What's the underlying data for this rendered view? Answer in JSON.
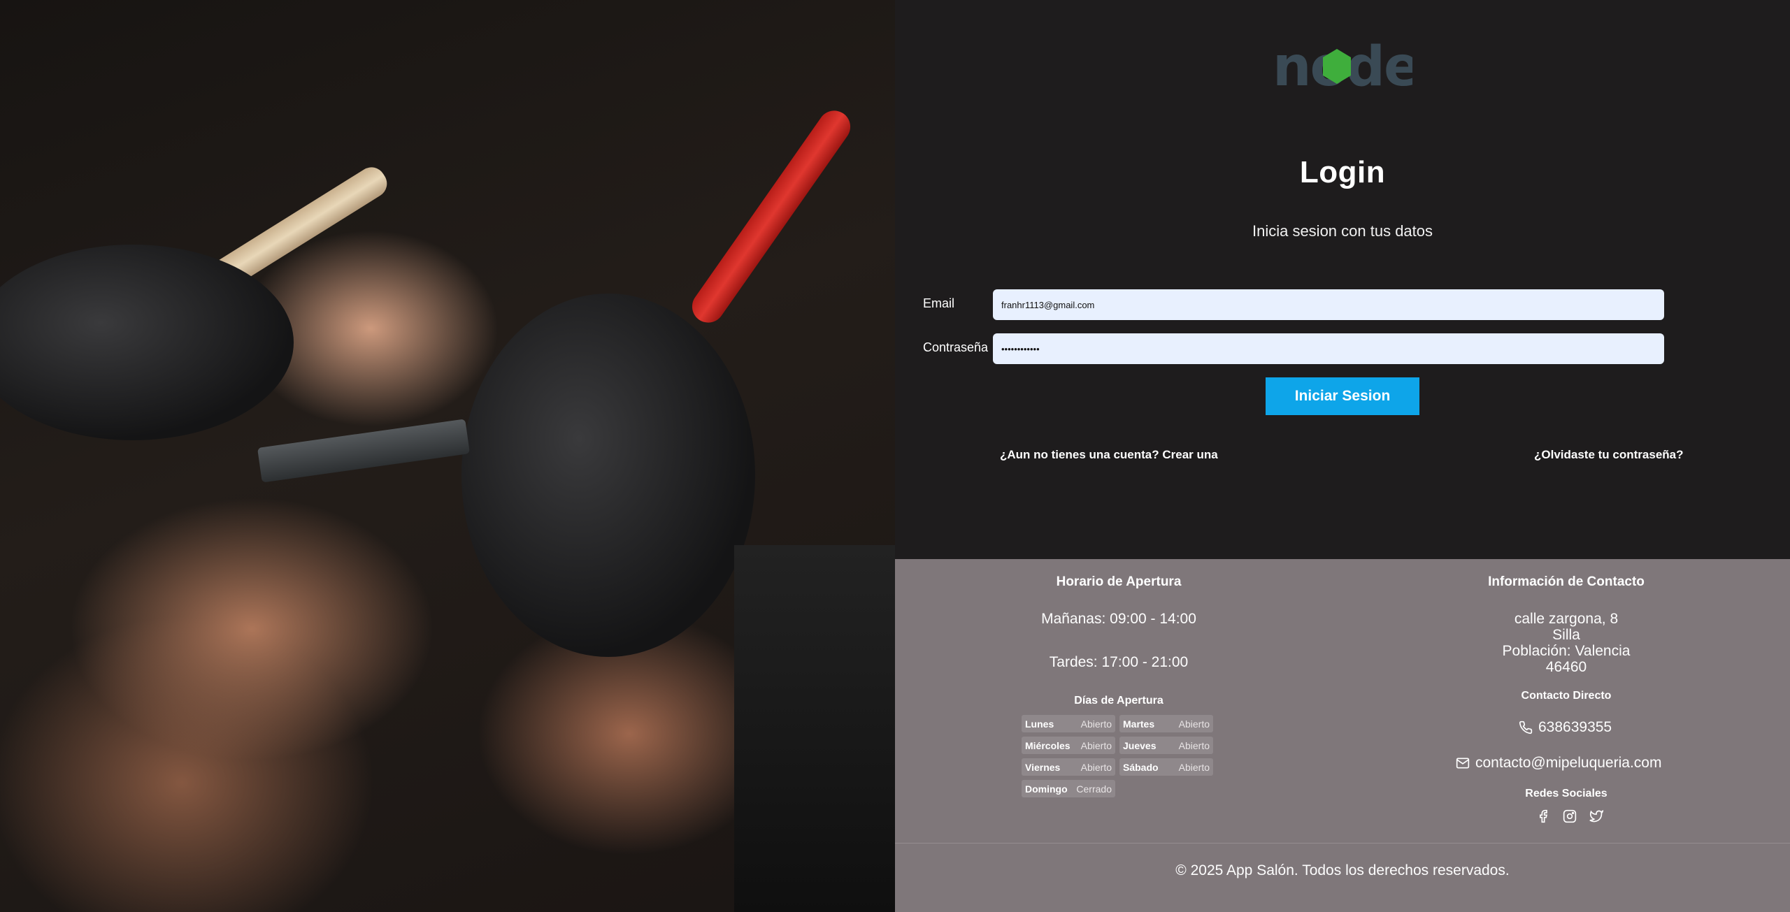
{
  "photo": {
    "alt": "barber-shaving-photo"
  },
  "login": {
    "logo_text": "node",
    "title": "Login",
    "subtitle": "Inicia sesion con tus datos",
    "email_label": "Email",
    "email_value": "franhr1113@gmail.com",
    "password_label": "Contraseña",
    "password_value": "••••••••••••",
    "submit_label": "Iniciar Sesion",
    "create_account_link": "¿Aun no tienes una cuenta? Crear una",
    "forgot_password_link": "¿Olvidaste tu contraseña?"
  },
  "footer": {
    "hours_title": "Horario de Apertura",
    "morning": "Mañanas: 09:00 - 14:00",
    "afternoon": "Tardes: 17:00 - 21:00",
    "days_title": "Días de Apertura",
    "days": [
      {
        "name": "Lunes",
        "state": "Abierto"
      },
      {
        "name": "Martes",
        "state": "Abierto"
      },
      {
        "name": "Miércoles",
        "state": "Abierto"
      },
      {
        "name": "Jueves",
        "state": "Abierto"
      },
      {
        "name": "Viernes",
        "state": "Abierto"
      },
      {
        "name": "Sábado",
        "state": "Abierto"
      },
      {
        "name": "Domingo",
        "state": "Cerrado"
      }
    ],
    "contact_title": "Información de Contacto",
    "address_street": "calle zargona, 8",
    "address_city": "Silla",
    "address_region": "Población: Valencia",
    "address_zip": "46460",
    "direct_title": "Contacto Directo",
    "phone": "638639355",
    "email": "contacto@mipeluqueria.com",
    "social_title": "Redes Sociales",
    "copyright": "© 2025 App Salón. Todos los derechos reservados."
  },
  "colors": {
    "accent": "#0ea5e9",
    "footer_bg": "#7f777a",
    "page_bg": "#1e1c1d",
    "input_bg": "#e8f0fe"
  }
}
